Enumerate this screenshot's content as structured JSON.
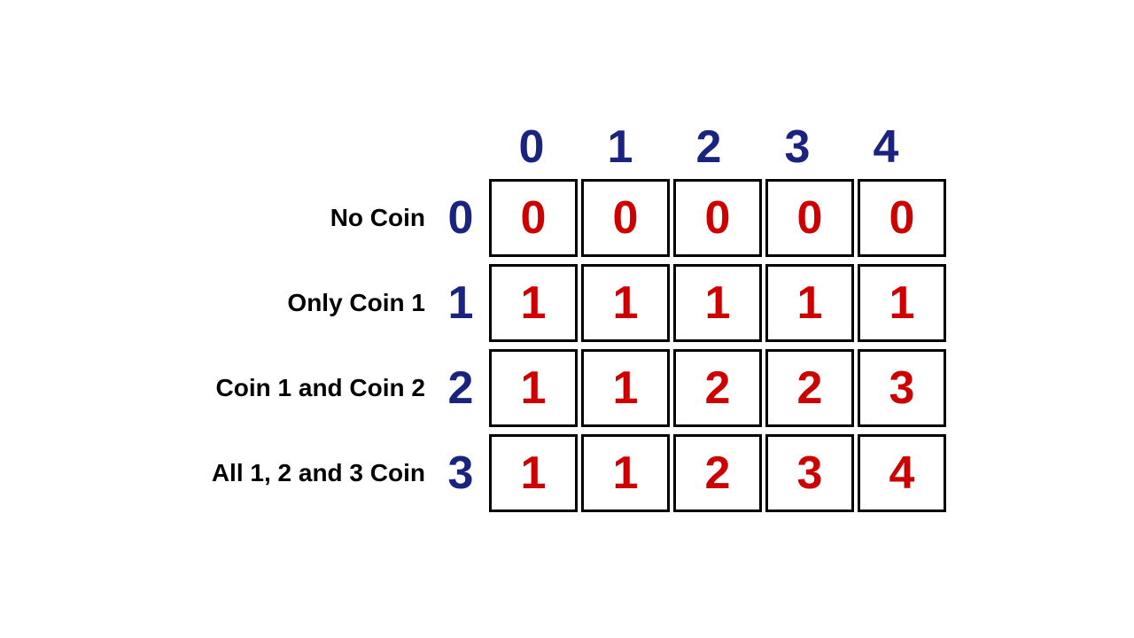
{
  "table": {
    "col_headers": [
      "0",
      "1",
      "2",
      "3",
      "4"
    ],
    "rows": [
      {
        "label": "No Coin",
        "index": "0",
        "cells": [
          "0",
          "0",
          "0",
          "0",
          "0"
        ]
      },
      {
        "label": "Only Coin 1",
        "index": "1",
        "cells": [
          "1",
          "1",
          "1",
          "1",
          "1"
        ]
      },
      {
        "label": "Coin 1 and Coin 2",
        "index": "2",
        "cells": [
          "1",
          "1",
          "2",
          "2",
          "3"
        ]
      },
      {
        "label": "All 1, 2 and 3 Coin",
        "index": "3",
        "cells": [
          "1",
          "1",
          "2",
          "3",
          "4"
        ]
      }
    ]
  }
}
